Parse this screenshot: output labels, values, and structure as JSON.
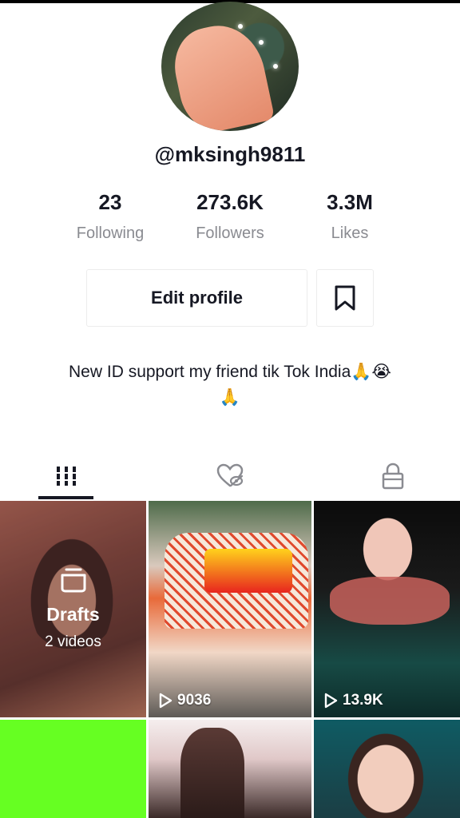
{
  "profile": {
    "username": "@mksingh9811",
    "stats": [
      {
        "value": "23",
        "label": "Following"
      },
      {
        "value": "273.6K",
        "label": "Followers"
      },
      {
        "value": "3.3M",
        "label": "Likes"
      }
    ],
    "edit_label": "Edit profile",
    "bio_line1": "New ID support my friend tik Tok India🙏😭",
    "bio_line2": "🙏"
  },
  "tabs": [
    {
      "icon": "grid-icon",
      "active": true
    },
    {
      "icon": "liked-hidden-icon",
      "active": false
    },
    {
      "icon": "lock-icon",
      "active": false
    }
  ],
  "videos": {
    "drafts_label": "Drafts",
    "drafts_count": "2 videos",
    "items": [
      {
        "views": "9036"
      },
      {
        "views": "13.9K"
      }
    ]
  },
  "colors": {
    "text": "#161823",
    "muted": "#8a8b91",
    "green_tile": "#66ff22"
  }
}
